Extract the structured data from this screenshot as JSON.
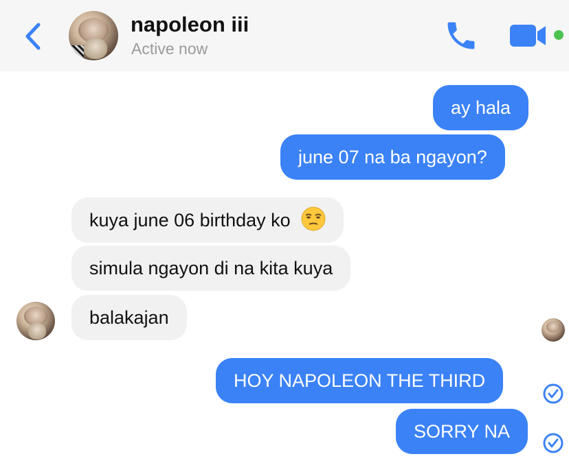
{
  "header": {
    "contact_name": "napoleon iii",
    "status": "Active now",
    "accent_color": "#3b82f6",
    "online_color": "#4cc24f",
    "icons": [
      "chevron-left-icon",
      "phone-icon",
      "video-camera-icon"
    ]
  },
  "messages": [
    {
      "from": "me",
      "text": "ay hala"
    },
    {
      "from": "me",
      "text": "june 07 na ba ngayon?"
    },
    {
      "from": "them",
      "text": "kuya june 06 birthday ko",
      "emoji": "unamused-face-emoji"
    },
    {
      "from": "them",
      "text": "simula ngayon di na kita kuya"
    },
    {
      "from": "them",
      "text": "balakajan"
    },
    {
      "from": "me",
      "text": "HOY NAPOLEON THE THIRD",
      "status": "sent-check-icon"
    },
    {
      "from": "me",
      "text": "SORRY NA",
      "status": "sent-check-icon"
    }
  ],
  "colors": {
    "outgoing_bubble": "#3b82f6",
    "incoming_bubble": "#f1f1f1",
    "header_bg": "#f6f6f6"
  }
}
